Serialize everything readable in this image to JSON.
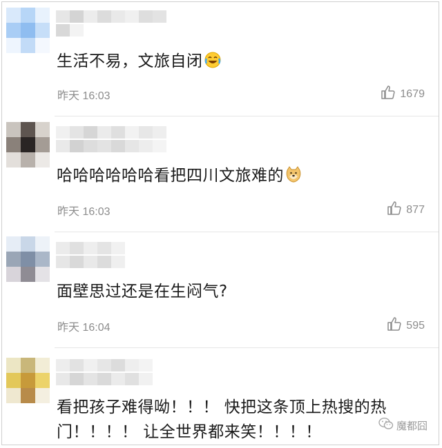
{
  "comments": [
    {
      "text": "生活不易，文旅自闭",
      "time": "昨天 16:03",
      "likes": "1679",
      "emoji": "laughing-crying-emoji"
    },
    {
      "text": "哈哈哈哈哈哈看把四川文旅难的",
      "time": "昨天 16:03",
      "likes": "877",
      "emoji": "doge-emoji"
    },
    {
      "text": "面壁思过还是在生闷气?",
      "time": "昨天 16:04",
      "likes": "595"
    },
    {
      "text_line1": "看把孩子难得呦！！！ 快把这条顶上热搜的热",
      "text_line2": "门！！！！ 让全世界都来笑！！！！"
    }
  ],
  "watermark": "魔都囧",
  "icons": {
    "like": "thumbs-up-icon",
    "watermark": "wechat-icon"
  },
  "colors": {
    "meta_text": "#8c8c8c",
    "divider": "#e6e6e6"
  }
}
